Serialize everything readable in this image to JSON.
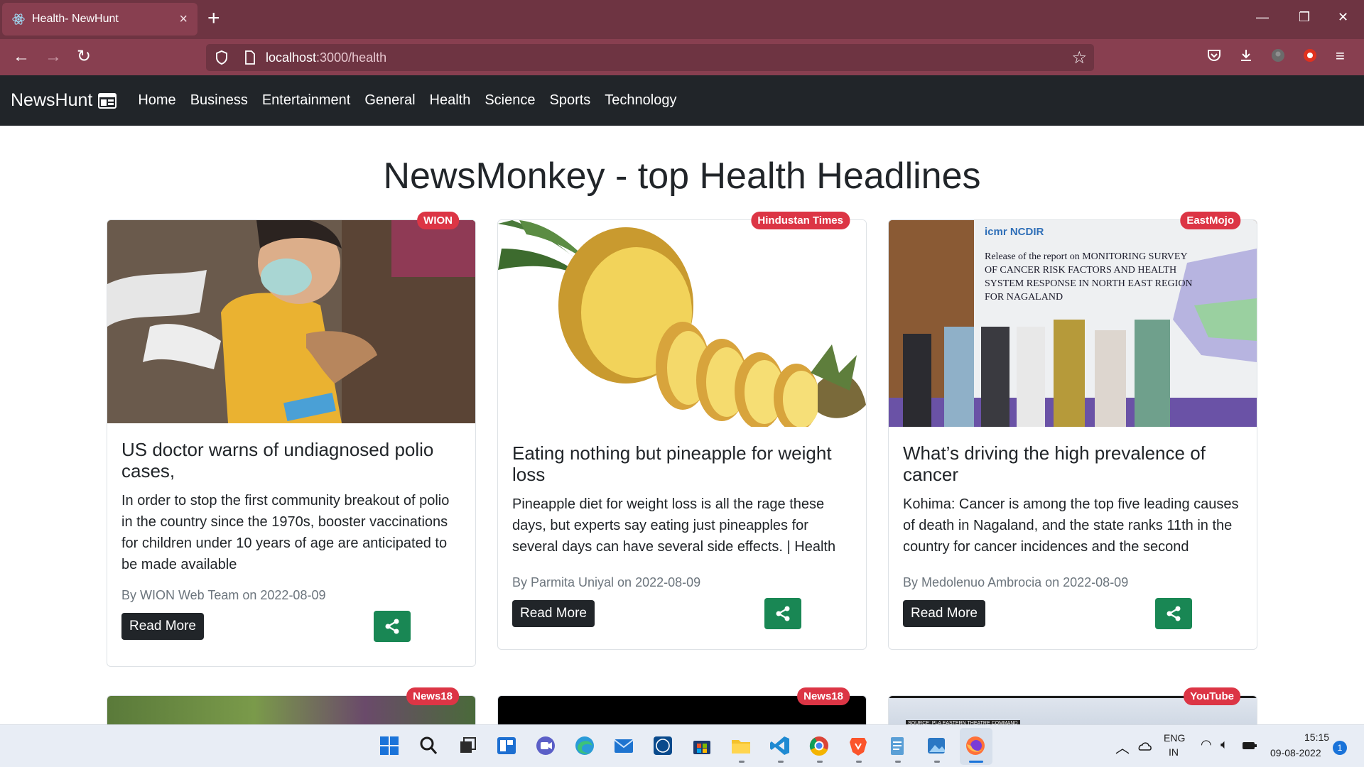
{
  "browser": {
    "tab_title": "Health- NewHunt",
    "url_host": "localhost",
    "url_path": ":3000/health"
  },
  "nav": {
    "brand": "NewsHunt",
    "links": [
      "Home",
      "Business",
      "Entertainment",
      "General",
      "Health",
      "Science",
      "Sports",
      "Technology"
    ]
  },
  "page": {
    "heading": "NewsMonkey - top Health Headlines"
  },
  "cards": [
    {
      "source": "WION",
      "title": "US doctor warns of undiagnosed polio cases,",
      "description": "In order to stop the first community breakout of polio in the country since the 1970s, booster vaccinations for children under 10 years of age are anticipated to be made available",
      "meta": "By WION Web Team on 2022-08-09",
      "read_more": "Read More"
    },
    {
      "source": "Hindustan Times",
      "title": "Eating nothing but pineapple for weight loss",
      "description": "Pineapple diet for weight loss is all the rage these days, but experts say eating just pineapples for several days can have several side effects. | Health",
      "meta": "By Parmita Uniyal on 2022-08-09",
      "read_more": "Read More"
    },
    {
      "source": "EastMojo",
      "title": "What’s driving the high prevalence of cancer",
      "description": "Kohima: Cancer is among the top five leading causes of death in Nagaland, and the state ranks 11th in the country for cancer incidences and the second",
      "meta": "By Medolenuo Ambrocia on 2022-08-09",
      "read_more": "Read More",
      "image_text": {
        "logos": "icmr NCDIR",
        "banner": "Release of the report on MONITORING SURVEY OF CANCER RISK FACTORS AND HEALTH SYSTEM RESPONSE IN NORTH EAST REGION FOR NAGALAND"
      }
    },
    {
      "source": "News18",
      "image_text": ""
    },
    {
      "source": "News18",
      "image_text": ""
    },
    {
      "source": "YouTube",
      "image_text": "SOURCE: PLA EASTERN THEATRE COMMAND"
    }
  ],
  "taskbar": {
    "lang": "ENG",
    "region": "IN",
    "time": "15:15",
    "date": "09-08-2022",
    "notifications": "1"
  },
  "colors": {
    "browser_frame": "#6e3442",
    "navbar": "#212529",
    "badge": "#dc3545",
    "share_button": "#198754",
    "read_more": "#212529"
  }
}
